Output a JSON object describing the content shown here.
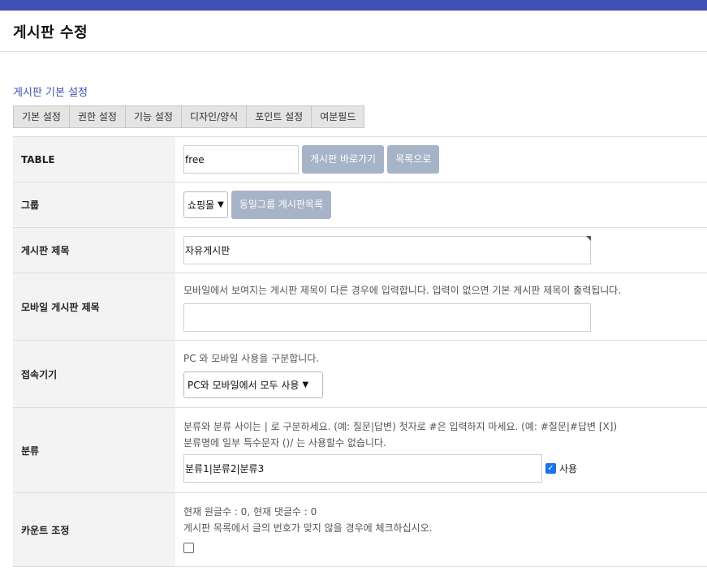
{
  "header": {
    "title": "게시판 수정"
  },
  "section": {
    "title": "게시판 기본 설정"
  },
  "tabs": [
    {
      "label": "기본 설정"
    },
    {
      "label": "권한 설정"
    },
    {
      "label": "기능 설정"
    },
    {
      "label": "디자인/양식"
    },
    {
      "label": "포인트 설정"
    },
    {
      "label": "여분필드"
    }
  ],
  "rows": {
    "table": {
      "label": "TABLE",
      "value": "free",
      "btn_goto": "게시판 바로가기",
      "btn_list": "목록으로"
    },
    "group": {
      "label": "그룹",
      "selected": "쇼핑몰",
      "btn_same_group": "동일그룹 게시판목록"
    },
    "subject": {
      "label": "게시판 제목",
      "value": "자유게시판"
    },
    "mobile_subject": {
      "label": "모바일 게시판 제목",
      "help": "모바일에서 보여지는 게시판 제목이 다른 경우에 입력합니다. 입력이 없으면 기본 게시판 제목이 출력됩니다.",
      "value": ""
    },
    "device": {
      "label": "접속기기",
      "help": "PC 와 모바일 사용을 구분합니다.",
      "selected": "PC와 모바일에서 모두 사용"
    },
    "category": {
      "label": "분류",
      "help1": "분류와 분류 사이는 | 로 구분하세요. (예: 질문|답변) 첫자로 #은 입력하지 마세요. (예: #질문|#답변 [X])",
      "help2": "분류명에 일부 특수문자 ()/ 는 사용할수 없습니다.",
      "value": "분류1|분류2|분류3",
      "use_label": "사용",
      "use_checked": true
    },
    "count": {
      "label": "카운트 조정",
      "help1": "현재 원글수 : 0, 현재 댓글수 : 0",
      "help2": "게시판 목록에서 글의 번호가 맞지 않을 경우에 체크하십시오.",
      "checked": false
    }
  },
  "colors": {
    "topbar": "#3f51b5",
    "button": "#a7b3c6",
    "section_title": "#3f51b5"
  }
}
